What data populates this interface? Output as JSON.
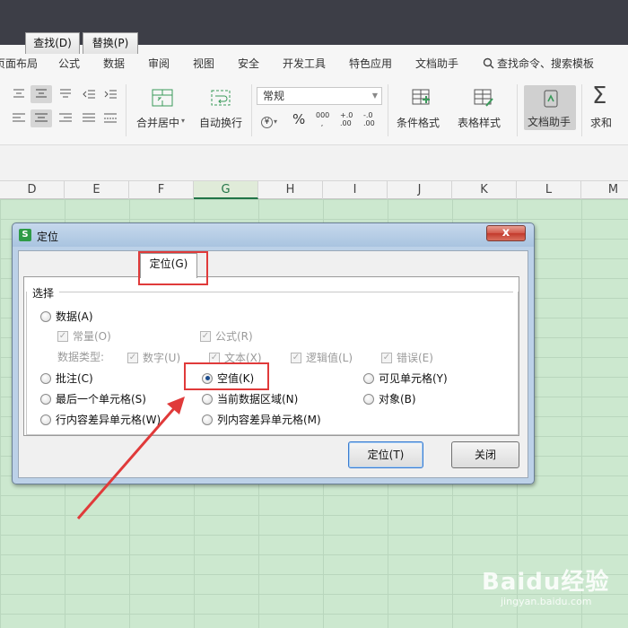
{
  "menu": {
    "items": [
      "页面布局",
      "公式",
      "数据",
      "审阅",
      "视图",
      "安全",
      "开发工具",
      "特色应用",
      "文档助手"
    ],
    "search_label": "查找命令、搜索模板"
  },
  "ribbon": {
    "merge_center": "合并居中",
    "auto_wrap": "自动换行",
    "number_format": "常规",
    "currency_symbol": "¥",
    "percent_symbol": "%",
    "thousands_symbol": "000",
    "inc_decimal": "+.0 .00",
    "dec_decimal": "-.0 .00",
    "cond_format": "条件格式",
    "table_style": "表格样式",
    "doc_assistant": "文档助手",
    "sum": "求和"
  },
  "columns": [
    "D",
    "E",
    "F",
    "G",
    "H",
    "I",
    "J",
    "K",
    "L",
    "M"
  ],
  "selected_column": "G",
  "dialog": {
    "title": "定位",
    "app_icon": "S",
    "close_glyph": "x",
    "tabs": [
      "查找(D)",
      "替换(P)",
      "定位(G)"
    ],
    "active_tab": "定位(G)",
    "group_label": "选择",
    "datatype_label": "数据类型:",
    "options": {
      "data": "数据(A)",
      "constant": "常量(O)",
      "formula": "公式(R)",
      "number": "数字(U)",
      "text": "文本(X)",
      "logical": "逻辑值(L)",
      "error": "错误(E)",
      "comment": "批注(C)",
      "blank": "空值(K)",
      "visible_cells": "可见单元格(Y)",
      "last_cell": "最后一个单元格(S)",
      "current_region": "当前数据区域(N)",
      "object": "对象(B)",
      "row_diff": "行内容差异单元格(W)",
      "col_diff": "列内容差异单元格(M)"
    },
    "selected_option": "空值(K)",
    "buttons": {
      "ok": "定位(T)",
      "close": "关闭"
    }
  },
  "watermark": {
    "brand": "Baidu经验",
    "url": "jingyan.baidu.com"
  },
  "colors": {
    "accent_green": "#227447",
    "annotation_red": "#e03a3a",
    "sheet_bg": "#cce8cf"
  }
}
